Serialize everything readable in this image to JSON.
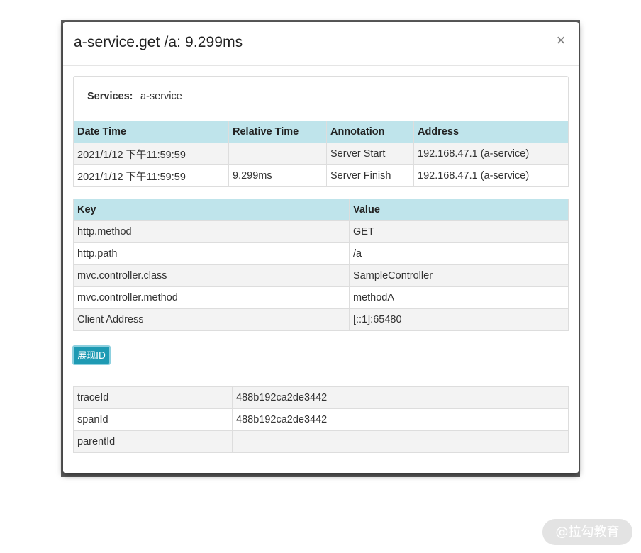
{
  "modal": {
    "title": "a-service.get /a: 9.299ms",
    "close_glyph": "×"
  },
  "services": {
    "label": "Services:",
    "value": "a-service"
  },
  "annotations_table": {
    "headers": [
      "Date Time",
      "Relative Time",
      "Annotation",
      "Address"
    ],
    "rows": [
      [
        "2021/1/12 下午11:59:59",
        "",
        "Server Start",
        "192.168.47.1 (a-service)"
      ],
      [
        "2021/1/12 下午11:59:59",
        "9.299ms",
        "Server Finish",
        "192.168.47.1 (a-service)"
      ]
    ]
  },
  "tags_table": {
    "headers": [
      "Key",
      "Value"
    ],
    "rows": [
      [
        "http.method",
        "GET"
      ],
      [
        "http.path",
        "/a"
      ],
      [
        "mvc.controller.class",
        "SampleController"
      ],
      [
        "mvc.controller.method",
        "methodA"
      ],
      [
        "Client Address",
        "[::1]:65480"
      ]
    ]
  },
  "show_ids_button": {
    "label": "展现ID"
  },
  "ids_table": {
    "rows": [
      [
        "traceId",
        "488b192ca2de3442"
      ],
      [
        "spanId",
        "488b192ca2de3442"
      ],
      [
        "parentId",
        ""
      ]
    ]
  },
  "watermark": {
    "text": "@拉勾教育"
  },
  "colors": {
    "header_bg": "#bfe4eb",
    "button_bg": "#1e9ab3",
    "stripe_bg": "#f3f3f3",
    "backdrop": "#5e5e5e"
  }
}
